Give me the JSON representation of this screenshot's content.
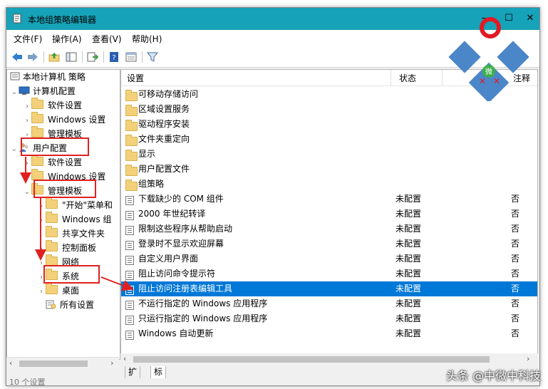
{
  "window": {
    "title": "本地组策略编辑器",
    "minimize": "—",
    "maximize": "☐",
    "close": "✕"
  },
  "menu": [
    "文件(F)",
    "操作(A)",
    "查看(V)",
    "帮助(H)"
  ],
  "tree": {
    "root": "本地计算机 策略",
    "computer_config": "计算机配置",
    "software_settings_1": "软件设置",
    "windows_settings_1": "Windows 设置",
    "admin_templates_1": "管理模板",
    "user_config": "用户配置",
    "software_settings_2": "软件设置",
    "windows_settings_2": "Windows 设置",
    "admin_templates_2": "管理模板",
    "start_menu": "\"开始\"菜单和",
    "windows_components": "Windows 组",
    "shared_folders": "共享文件夹",
    "control_panel": "控制面板",
    "network": "网络",
    "system": "系统",
    "desktop": "桌面",
    "all_settings": "所有设置"
  },
  "list": {
    "col_setting": "设置",
    "col_state": "状态",
    "col_comment": "注释",
    "folders": [
      "可移动存储访问",
      "区域设置服务",
      "驱动程序安装",
      "文件夹重定向",
      "显示",
      "用户配置文件",
      "组策略"
    ],
    "policies": [
      {
        "name": "下载缺少的 COM 组件",
        "state": "未配置",
        "comment": "否"
      },
      {
        "name": "2000 年世纪转译",
        "state": "未配置",
        "comment": "否"
      },
      {
        "name": "限制这些程序从帮助启动",
        "state": "未配置",
        "comment": "否"
      },
      {
        "name": "登录时不显示欢迎屏幕",
        "state": "未配置",
        "comment": "否"
      },
      {
        "name": "自定义用户界面",
        "state": "未配置",
        "comment": "否"
      },
      {
        "name": "阻止访问命令提示符",
        "state": "未配置",
        "comment": "否"
      },
      {
        "name": "阻止访问注册表编辑工具",
        "state": "未配置",
        "comment": "否"
      },
      {
        "name": "不运行指定的 Windows 应用程序",
        "state": "未配置",
        "comment": "否"
      },
      {
        "name": "只运行指定的 Windows 应用程序",
        "state": "未配置",
        "comment": "否"
      },
      {
        "name": "Windows 自动更新",
        "state": "未配置",
        "comment": "否"
      }
    ]
  },
  "tabs": [
    "扩展",
    "标准"
  ],
  "status_text": "10 个设置",
  "watermark": {
    "logo_char": "微",
    "text": "头条 @中微中科技"
  },
  "colors": {
    "titlebar": "#16a2b8",
    "selection": "#0078d7",
    "annotation": "#e02020",
    "logo_blue": "#4a86c8",
    "logo_red": "#e01b24"
  }
}
